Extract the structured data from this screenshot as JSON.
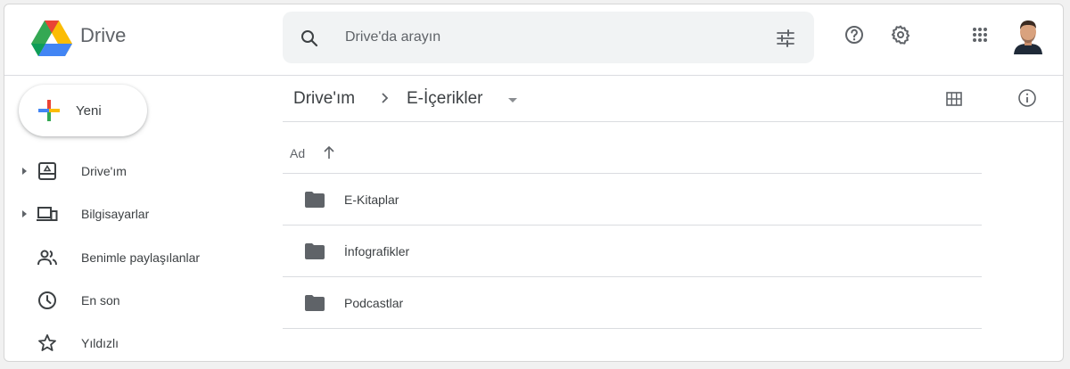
{
  "header": {
    "product_name": "Drive",
    "search_placeholder": "Drive'da arayın",
    "icons": [
      "search-icon",
      "search-options-icon",
      "help-icon",
      "settings-icon",
      "apps-grid-icon",
      "avatar"
    ]
  },
  "sidebar": {
    "new_label": "Yeni",
    "items": [
      {
        "label": "Drive'ım",
        "icon": "my-drive-icon",
        "expandable": true
      },
      {
        "label": "Bilgisayarlar",
        "icon": "computers-icon",
        "expandable": true
      },
      {
        "label": "Benimle paylaşılanlar",
        "icon": "shared-icon",
        "expandable": false
      },
      {
        "label": "En son",
        "icon": "clock-icon",
        "expandable": false
      },
      {
        "label": "Yıldızlı",
        "icon": "star-icon",
        "expandable": false
      }
    ]
  },
  "main": {
    "breadcrumb": {
      "root": "Drive'ım",
      "current": "E-İçerikler"
    },
    "column_header": "Ad",
    "rows": [
      {
        "name": "E-Kitaplar"
      },
      {
        "name": "İnfografikler"
      },
      {
        "name": "Podcastlar"
      }
    ]
  },
  "colors": {
    "accent_blue": "#4285f4",
    "accent_red": "#ea4335",
    "accent_yellow": "#fbbc04",
    "accent_green": "#34a853",
    "folder": "#5f6368"
  }
}
